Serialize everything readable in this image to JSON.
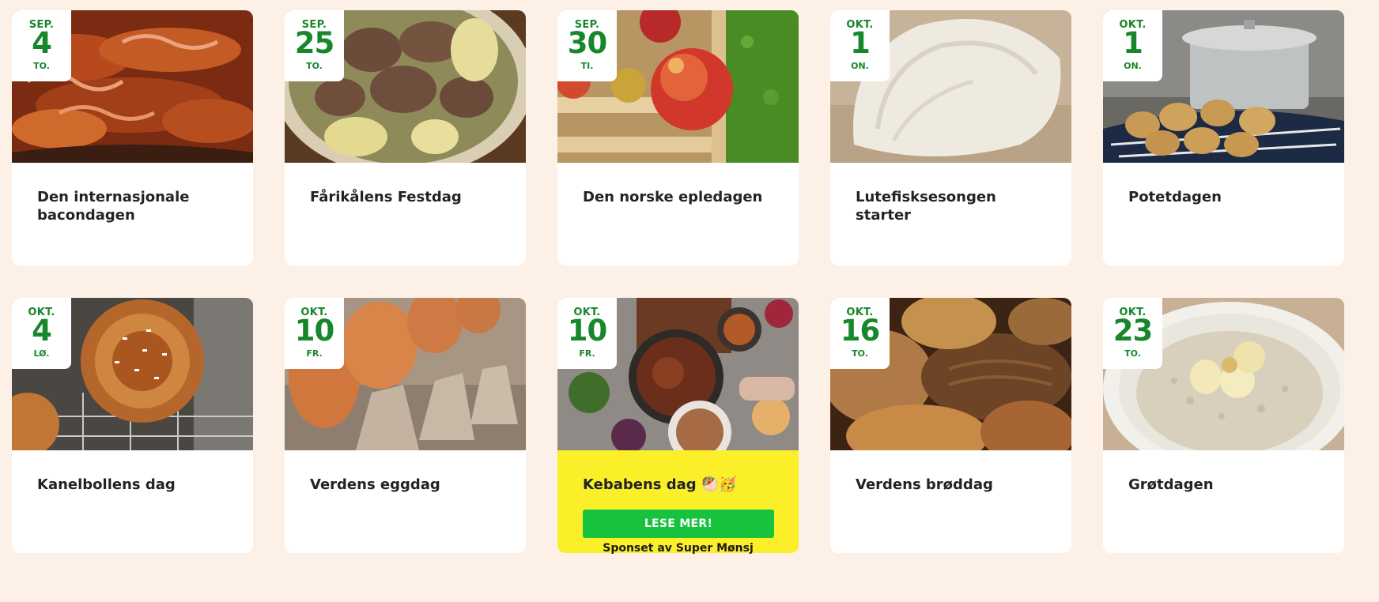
{
  "events": [
    {
      "month": "SEP.",
      "day": "4",
      "weekday": "TO.",
      "title": "Den internasjonale bacondagen",
      "image": "bacon-photo"
    },
    {
      "month": "SEP.",
      "day": "25",
      "weekday": "TO.",
      "title": "Fårikålens Festdag",
      "image": "farikal-photo"
    },
    {
      "month": "SEP.",
      "day": "30",
      "weekday": "TI.",
      "title": "Den norske epledagen",
      "image": "apple-photo"
    },
    {
      "month": "OKT.",
      "day": "1",
      "weekday": "ON.",
      "title": "Lutefisksesongen starter",
      "image": "lutefisk-photo"
    },
    {
      "month": "OKT.",
      "day": "1",
      "weekday": "ON.",
      "title": "Potetdagen",
      "image": "potato-photo"
    },
    {
      "month": "OKT.",
      "day": "4",
      "weekday": "LØ.",
      "title": "Kanelbollens dag",
      "image": "cinnamon-bun-photo"
    },
    {
      "month": "OKT.",
      "day": "10",
      "weekday": "FR.",
      "title": "Verdens eggdag",
      "image": "egg-photo"
    },
    {
      "month": "OKT.",
      "day": "10",
      "weekday": "FR.",
      "title": "Kebabens dag 🥙🥳",
      "image": "kebab-photo",
      "sponsored": true,
      "cta_label": "LESE MER!",
      "sponsor_text": "Sponset av Super Mønsj"
    },
    {
      "month": "OKT.",
      "day": "16",
      "weekday": "TO.",
      "title": "Verdens brøddag",
      "image": "bread-photo"
    },
    {
      "month": "OKT.",
      "day": "23",
      "weekday": "TO.",
      "title": "Grøtdagen",
      "image": "porridge-photo"
    }
  ],
  "colors": {
    "page_background": "#fdf0e6",
    "date_green": "#17872b",
    "sponsored_background": "#fbef2a",
    "cta_green": "#17c23c",
    "title_text": "#222326"
  }
}
